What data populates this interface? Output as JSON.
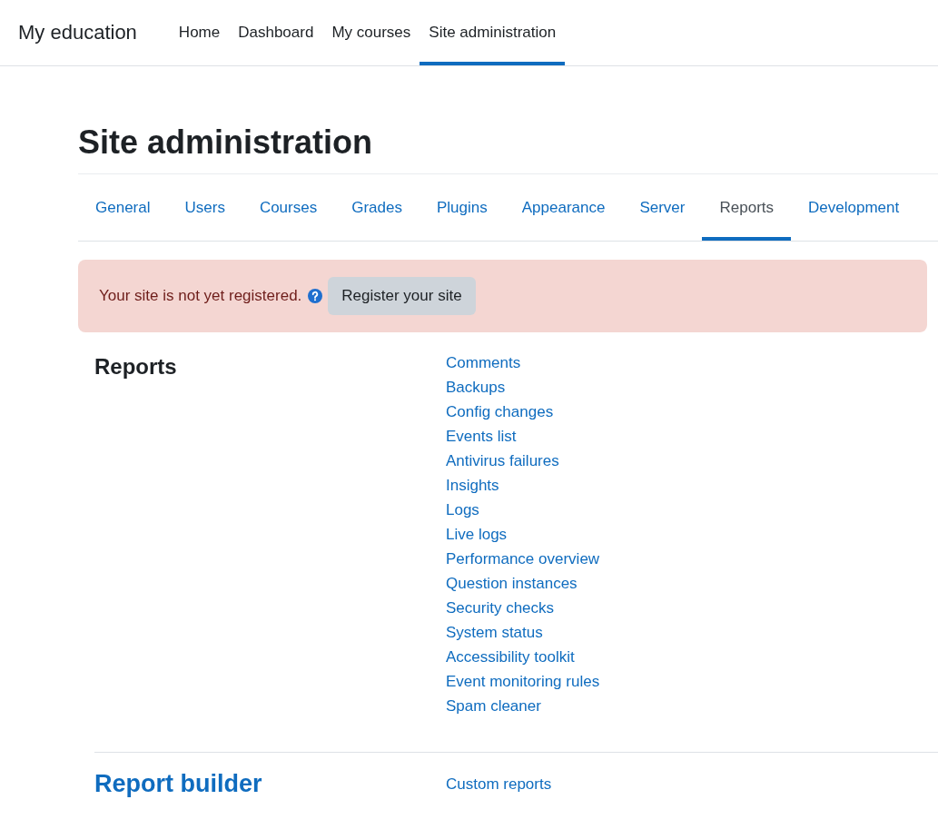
{
  "header": {
    "brand": "My education",
    "nav": [
      {
        "label": "Home",
        "selected": false
      },
      {
        "label": "Dashboard",
        "selected": false
      },
      {
        "label": "My courses",
        "selected": false
      },
      {
        "label": "Site administration",
        "selected": true
      }
    ]
  },
  "page": {
    "title": "Site administration",
    "tabs": [
      {
        "label": "General",
        "selected": false
      },
      {
        "label": "Users",
        "selected": false
      },
      {
        "label": "Courses",
        "selected": false
      },
      {
        "label": "Grades",
        "selected": false
      },
      {
        "label": "Plugins",
        "selected": false
      },
      {
        "label": "Appearance",
        "selected": false
      },
      {
        "label": "Server",
        "selected": false
      },
      {
        "label": "Reports",
        "selected": true
      },
      {
        "label": "Development",
        "selected": false
      }
    ],
    "alert": {
      "message": "Your site is not yet registered.",
      "button": "Register your site"
    },
    "sections": [
      {
        "title": "Reports",
        "linked": false,
        "links": [
          "Comments",
          "Backups",
          "Config changes",
          "Events list",
          "Antivirus failures",
          "Insights",
          "Logs",
          "Live logs",
          "Performance overview",
          "Question instances",
          "Security checks",
          "System status",
          "Accessibility toolkit",
          "Event monitoring rules",
          "Spam cleaner"
        ]
      },
      {
        "title": "Report builder",
        "linked": true,
        "links": [
          "Custom reports"
        ]
      }
    ]
  }
}
